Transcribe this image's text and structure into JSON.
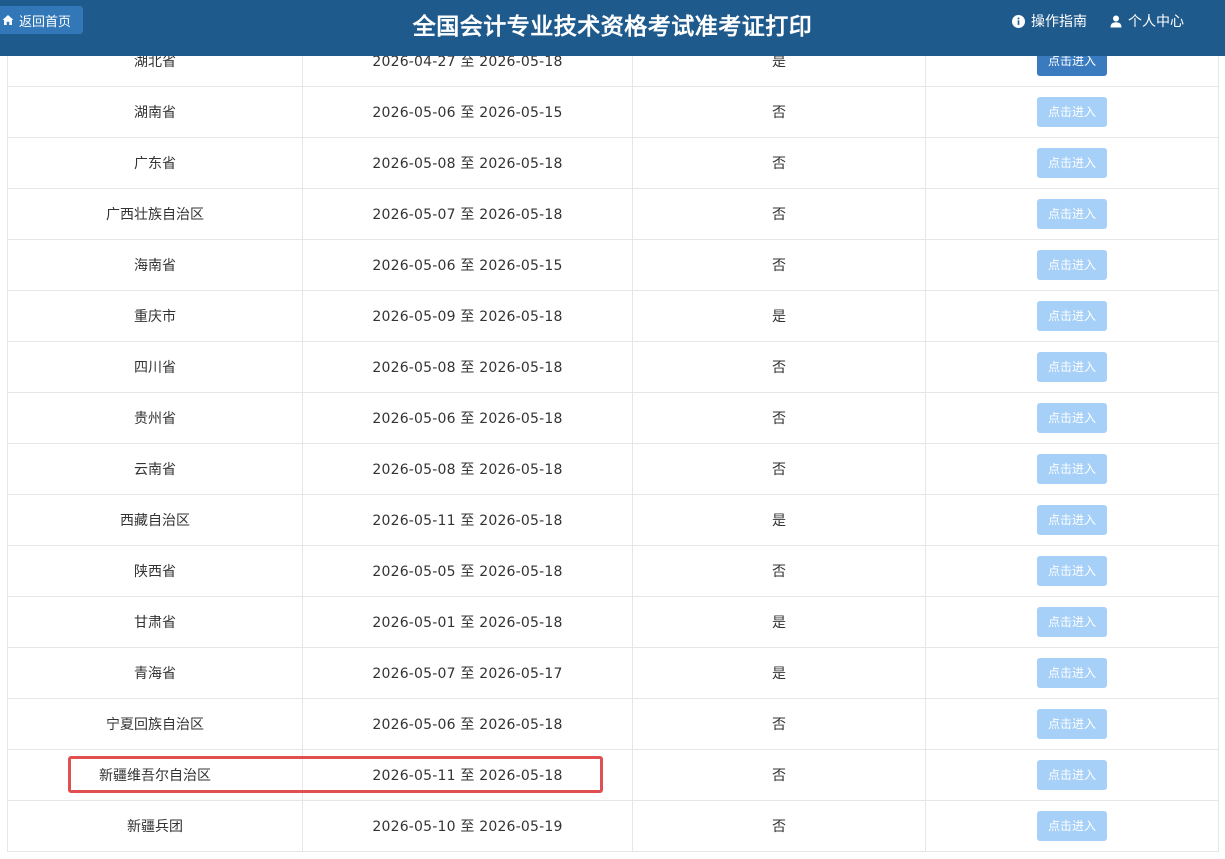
{
  "header": {
    "home_label": "返回首页",
    "title": "全国会计专业技术资格考试准考证打印",
    "guide_label": "操作指南",
    "user_label": "个人中心"
  },
  "table": {
    "button_label": "点击进入",
    "rows": [
      {
        "province": "湖北省",
        "period": "2026-04-27 至 2026-05-18",
        "flag": "是",
        "enabled": true
      },
      {
        "province": "湖南省",
        "period": "2026-05-06 至 2026-05-15",
        "flag": "否",
        "enabled": false
      },
      {
        "province": "广东省",
        "period": "2026-05-08 至 2026-05-18",
        "flag": "否",
        "enabled": false
      },
      {
        "province": "广西壮族自治区",
        "period": "2026-05-07 至 2026-05-18",
        "flag": "否",
        "enabled": false
      },
      {
        "province": "海南省",
        "period": "2026-05-06 至 2026-05-15",
        "flag": "否",
        "enabled": false
      },
      {
        "province": "重庆市",
        "period": "2026-05-09 至 2026-05-18",
        "flag": "是",
        "enabled": false
      },
      {
        "province": "四川省",
        "period": "2026-05-08 至 2026-05-18",
        "flag": "否",
        "enabled": false
      },
      {
        "province": "贵州省",
        "period": "2026-05-06 至 2026-05-18",
        "flag": "否",
        "enabled": false
      },
      {
        "province": "云南省",
        "period": "2026-05-08 至 2026-05-18",
        "flag": "否",
        "enabled": false
      },
      {
        "province": "西藏自治区",
        "period": "2026-05-11 至 2026-05-18",
        "flag": "是",
        "enabled": false
      },
      {
        "province": "陕西省",
        "period": "2026-05-05 至 2026-05-18",
        "flag": "否",
        "enabled": false
      },
      {
        "province": "甘肃省",
        "period": "2026-05-01 至 2026-05-18",
        "flag": "是",
        "enabled": false
      },
      {
        "province": "青海省",
        "period": "2026-05-07 至 2026-05-17",
        "flag": "是",
        "enabled": false
      },
      {
        "province": "宁夏回族自治区",
        "period": "2026-05-06 至 2026-05-18",
        "flag": "否",
        "enabled": false
      },
      {
        "province": "新疆维吾尔自治区",
        "period": "2026-05-11 至 2026-05-18",
        "flag": "否",
        "enabled": false
      },
      {
        "province": "新疆兵团",
        "period": "2026-05-10 至 2026-05-19",
        "flag": "否",
        "enabled": false
      }
    ]
  },
  "colors": {
    "header_bg": "#1f5a8c",
    "button_active": "#3a7bbf",
    "button_disabled": "#a6d0f7",
    "highlight": "#e05050"
  },
  "icons": {
    "home": "home-icon",
    "guide": "info-icon",
    "user": "user-icon"
  }
}
